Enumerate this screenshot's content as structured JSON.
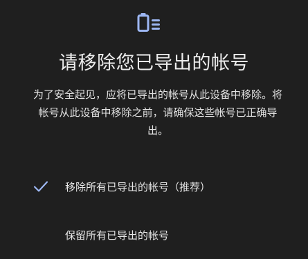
{
  "dialog": {
    "icon": "device-list-icon",
    "title": "请移除您已导出的帐号",
    "description": "为了安全起见，应将已导出的帐号从此设备中移除。将帐号从此设备中移除之前，请确保这些帐号已正确导出。"
  },
  "options": [
    {
      "label": "移除所有已导出的帐号（推荐）",
      "selected": true,
      "icon": "checkmark-icon"
    },
    {
      "label": "保留所有已导出的帐号",
      "selected": false
    }
  ],
  "colors": {
    "background": "#1f1f1f",
    "accent": "#9db7f3",
    "text": "#e6e6e6"
  }
}
